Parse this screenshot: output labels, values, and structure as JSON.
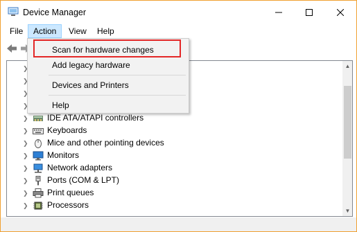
{
  "window": {
    "title": "Device Manager",
    "controls": [
      "minimize",
      "maximize",
      "close"
    ]
  },
  "menubar": {
    "items": [
      {
        "label": "File",
        "active": false
      },
      {
        "label": "Action",
        "active": true
      },
      {
        "label": "View",
        "active": false
      },
      {
        "label": "Help",
        "active": false
      }
    ]
  },
  "toolbar": {
    "buttons": [
      "back-arrow-icon",
      "forward-arrow-icon"
    ]
  },
  "action_menu": {
    "items": [
      {
        "label": "Scan for hardware changes",
        "highlighted": true
      },
      {
        "label": "Add legacy hardware"
      },
      {
        "label": "Devices and Printers"
      },
      {
        "label": "Help"
      }
    ],
    "highlight_color": "#e32626"
  },
  "tree": {
    "items": [
      {
        "label": "IDE ATA/ATAPI controllers",
        "icon": "ide-controller-icon"
      },
      {
        "label": "Keyboards",
        "icon": "keyboard-icon"
      },
      {
        "label": "Mice and other pointing devices",
        "icon": "mouse-icon"
      },
      {
        "label": "Monitors",
        "icon": "monitor-icon"
      },
      {
        "label": "Network adapters",
        "icon": "network-adapter-icon"
      },
      {
        "label": "Ports (COM & LPT)",
        "icon": "port-icon"
      },
      {
        "label": "Print queues",
        "icon": "printer-icon"
      },
      {
        "label": "Processors",
        "icon": "processor-icon"
      }
    ]
  },
  "colors": {
    "window_border": "#f0a030",
    "menu_active_bg": "#cce8ff",
    "menu_bg": "#f2f2f2"
  }
}
